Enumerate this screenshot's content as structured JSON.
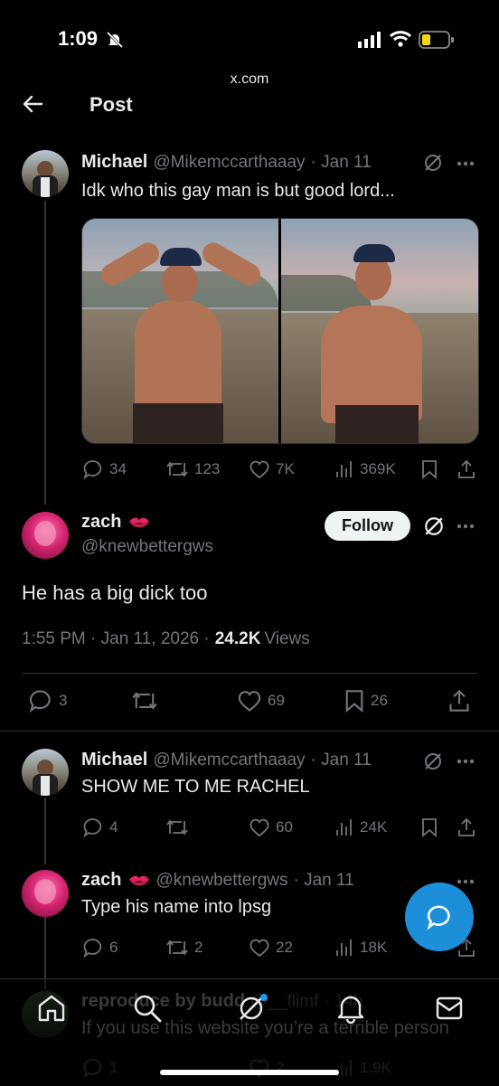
{
  "status_bar": {
    "time": "1:09",
    "url": "x.com"
  },
  "header": {
    "title": "Post"
  },
  "posts": [
    {
      "name": "Michael",
      "handle": "@Mikemccarthaaay",
      "date": "· Jan 11",
      "text": "Idk who this gay man is but good lord...",
      "replies": "34",
      "reposts": "123",
      "likes": "7K",
      "views": "369K"
    },
    {
      "name": "zach",
      "handle": "@knewbettergws",
      "text": "He has a big dick too",
      "follow_label": "Follow",
      "timestamp": "1:55 PM · Jan 11, 2026 · ",
      "views_count": "24.2K",
      "views_label": " Views",
      "replies": "3",
      "reposts": "",
      "likes": "69",
      "bookmarks": "26"
    },
    {
      "name": "Michael",
      "handle": "@Mikemccarthaaay",
      "date": "· Jan 11",
      "text": "SHOW ME TO ME RACHEL",
      "replies": "4",
      "reposts": "",
      "likes": "60",
      "views": "24K"
    },
    {
      "name": "zach",
      "handle": "@knewbettergws",
      "date": "· Jan 11",
      "text": "Type his name into lpsg",
      "replies": "6",
      "reposts": "2",
      "likes": "22",
      "views": "18K"
    },
    {
      "name": "reproduce by budd",
      "handle": "@__flimf",
      "date": "· 14h",
      "text": "If you use this website you’re a terrible person",
      "replies": "1",
      "likes": "2",
      "views": "1.9K"
    }
  ],
  "colors": {
    "accent": "#1d9bf0",
    "fab": "#1d8fd8",
    "emoji": "#e0245e"
  }
}
